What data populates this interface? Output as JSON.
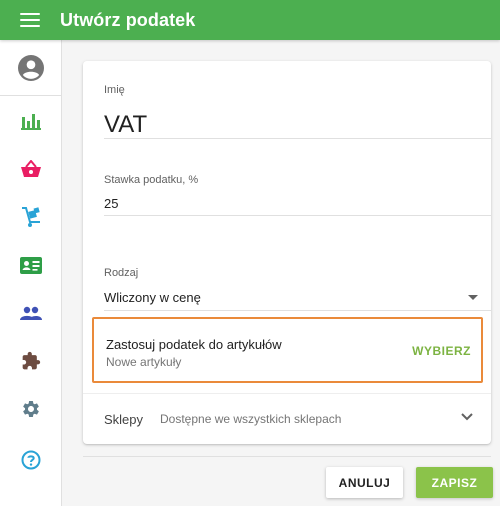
{
  "header": {
    "title": "Utwórz podatek",
    "menu_icon": "hamburger-menu-icon",
    "background": "#4caf50"
  },
  "sidebar": {
    "items": [
      {
        "name": "account",
        "icon": "account-circle-icon",
        "color": "#757575"
      },
      {
        "name": "reports",
        "icon": "bar-chart-icon",
        "color": "#4caf50"
      },
      {
        "name": "sales",
        "icon": "shopping-basket-icon",
        "color": "#e91e63"
      },
      {
        "name": "items",
        "icon": "dolly-cart-icon",
        "color": "#29a3d6"
      },
      {
        "name": "employees",
        "icon": "badge-card-icon",
        "color": "#2e9e47"
      },
      {
        "name": "customers",
        "icon": "people-icon",
        "color": "#3f51b5"
      },
      {
        "name": "integrations",
        "icon": "puzzle-icon",
        "color": "#6d4c41"
      },
      {
        "name": "settings",
        "icon": "gear-icon",
        "color": "#607d8b"
      },
      {
        "name": "help",
        "icon": "help-circle-icon",
        "color": "#29a3d6"
      }
    ]
  },
  "form": {
    "name": {
      "label": "Imię",
      "value": "VAT"
    },
    "rate": {
      "label": "Stawka podatku, %",
      "value": "25"
    },
    "type": {
      "label": "Rodzaj",
      "value": "Wliczony w cenę",
      "icon": "dropdown-arrow-icon"
    },
    "apply": {
      "title": "Zastosuj podatek do artykułów",
      "subtitle": "Nowe artykuły",
      "action": "WYBIERZ",
      "highlight_color": "#ea8a3a"
    },
    "stores": {
      "label": "Sklepy",
      "value": "Dostępne we wszystkich sklepach",
      "icon": "chevron-down-icon"
    }
  },
  "footer": {
    "cancel_label": "ANULUJ",
    "save_label": "ZAPISZ",
    "save_color": "#8bc34a"
  }
}
